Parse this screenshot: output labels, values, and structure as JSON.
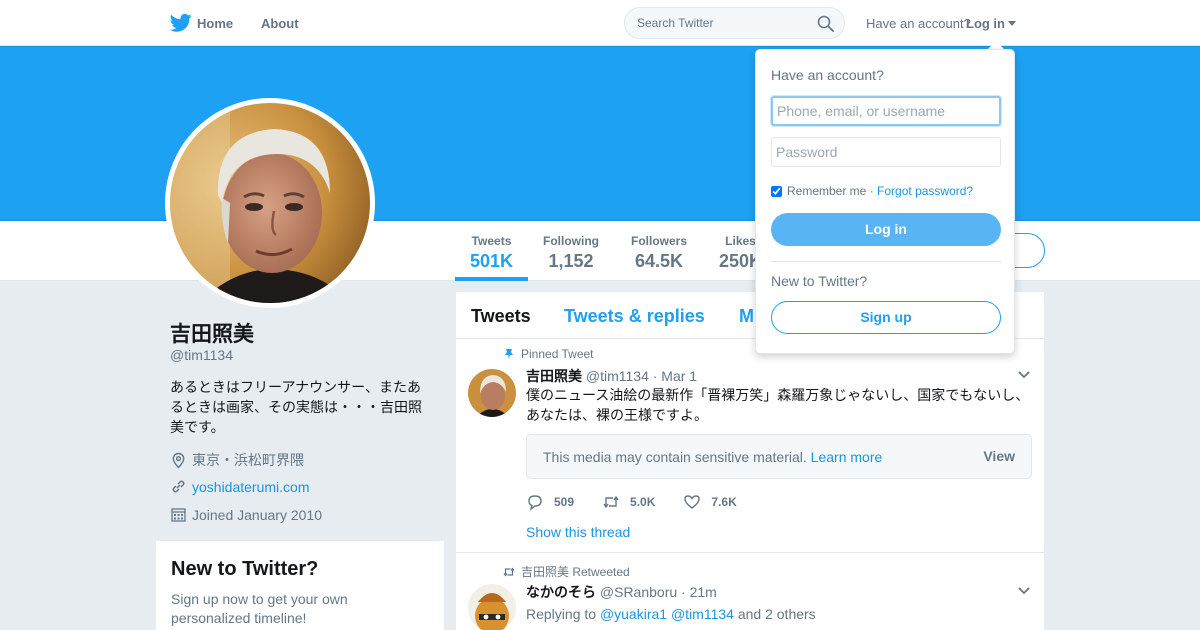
{
  "topnav": {
    "home_label": "Home",
    "about_label": "About",
    "search_placeholder": "Search Twitter",
    "have_account": "Have an account?",
    "login_label": "Log in"
  },
  "profile": {
    "name": "吉田照美",
    "handle": "@tim1134",
    "bio": "あるときはフリーアナウンサー、またあるときは画家、その実態は・・・吉田照美です。",
    "location": "東京・浜松町界隈",
    "website": "yoshidaterumi.com",
    "joined": "Joined January 2010"
  },
  "stats": [
    {
      "label": "Tweets",
      "value": "501K"
    },
    {
      "label": "Following",
      "value": "1,152"
    },
    {
      "label": "Followers",
      "value": "64.5K"
    },
    {
      "label": "Likes",
      "value": "250K"
    }
  ],
  "signup_card": {
    "title": "New to Twitter?",
    "text": "Sign up now to get your own personalized timeline!"
  },
  "tabs": [
    "Tweets",
    "Tweets & replies",
    "M"
  ],
  "tweets": [
    {
      "context": "Pinned Tweet",
      "name": "吉田照美",
      "handle_date": "@tim1134 · Mar 1",
      "text": "僕のニュース油絵の最新作「晋裸万笑」森羅万象じゃないし、国家でもないし、あなたは、裸の王様ですよ。",
      "sensitive_text": "This media may contain sensitive material.",
      "learn_more": "Learn more",
      "view": "View",
      "replies": "509",
      "retweets": "5.0K",
      "likes": "7.6K",
      "show_thread": "Show this thread"
    },
    {
      "context": "吉田照美 Retweeted",
      "name": "なかのそら",
      "handle_date": "@SRanboru · 21m",
      "replying_prefix": "Replying to",
      "replying_user1": "@yuakira1",
      "replying_user2": "@tim1134",
      "replying_suffix": "and 2 others"
    }
  ],
  "dropdown": {
    "title": "Have an account?",
    "username_placeholder": "Phone, email, or username",
    "password_placeholder": "Password",
    "remember": "Remember me",
    "separator": "·",
    "forgot": "Forgot password?",
    "login_button": "Log in",
    "new_to_twitter": "New to Twitter?",
    "signup_button": "Sign up"
  },
  "colors": {
    "brand": "#1da1f2",
    "link": "#1b95e0",
    "muted": "#657786"
  }
}
